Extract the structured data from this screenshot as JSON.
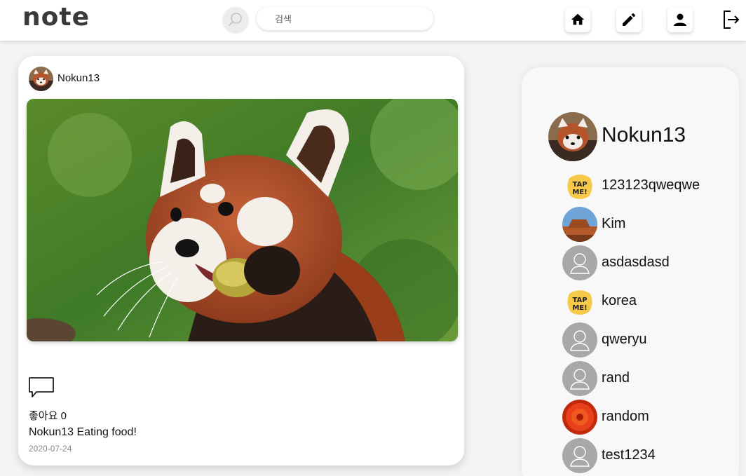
{
  "header": {
    "logo": "note",
    "search": {
      "placeholder": "검색",
      "value": "검색"
    },
    "nav": [
      "home-icon",
      "edit-icon",
      "person-icon",
      "logout-icon"
    ]
  },
  "post": {
    "username": "Nokun13",
    "likes_label": "좋아요 0",
    "caption": "Nokun13 Eating food!",
    "date": "2020-07-24"
  },
  "sidebar": {
    "profile_name": "Nokun13",
    "users": [
      {
        "name": "123123qweqwe",
        "avatar": "tap-me-sticker"
      },
      {
        "name": "Kim",
        "avatar": "desert-photo"
      },
      {
        "name": "asdasdasd",
        "avatar": "default-avatar"
      },
      {
        "name": "korea",
        "avatar": "tap-me-sticker"
      },
      {
        "name": "qweryu",
        "avatar": "default-avatar"
      },
      {
        "name": "rand",
        "avatar": "default-avatar"
      },
      {
        "name": "random",
        "avatar": "flower-photo"
      },
      {
        "name": "test1234",
        "avatar": "default-avatar"
      }
    ]
  },
  "colors": {
    "accent": "#3a3a3a",
    "background": "#f4f4f4",
    "card": "#ffffff"
  }
}
